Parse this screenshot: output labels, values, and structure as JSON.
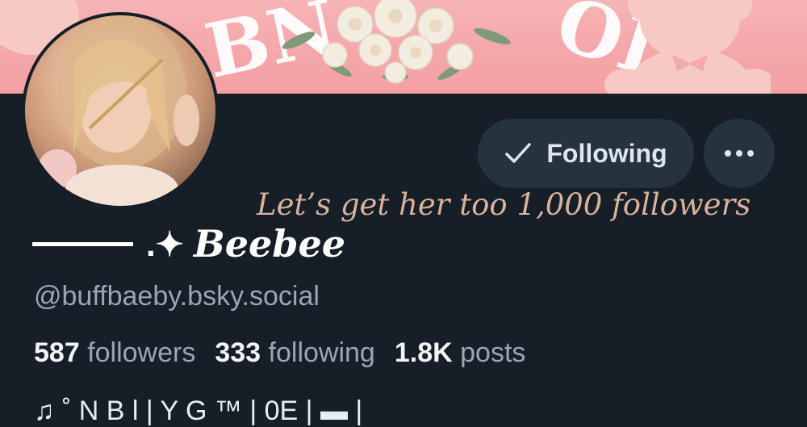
{
  "banner": {
    "watermark_left": "BN",
    "watermark_right": "OL"
  },
  "actions": {
    "following_label": "Following",
    "more_label": "•••"
  },
  "overlay_caption": "Let’s get her too 1,000 followers",
  "profile": {
    "name_decoration": ".✦",
    "display_name": "Beebee",
    "handle": "@buffbaeby.bsky.social"
  },
  "stats": {
    "followers_count": "587",
    "followers_label": "followers",
    "following_count": "333",
    "following_label": "following",
    "posts_count": "1.8K",
    "posts_label": "posts"
  },
  "bio_partial": "♫  ˚ N         B       l | Y           G  ™ | 0E |  ▬  |",
  "colors": {
    "background": "#161e27",
    "button_bg": "#27323f",
    "muted_text": "#9aa6b3",
    "caption": "#d9b29a",
    "banner_pink": "#f5a7aa"
  }
}
